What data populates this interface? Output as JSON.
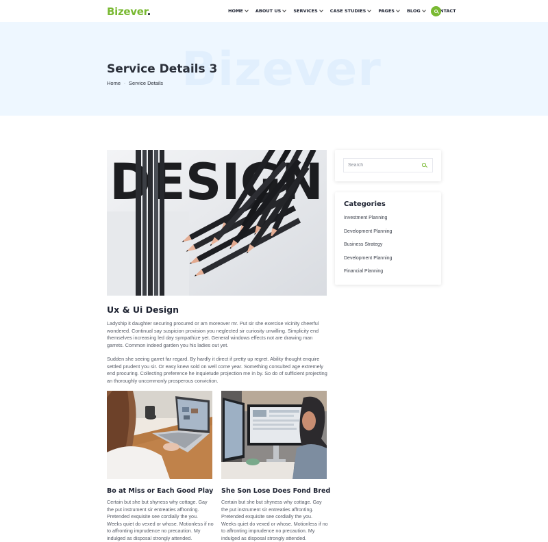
{
  "header": {
    "logo_main": "Bizever",
    "logo_dot": ".",
    "nav": [
      {
        "label": "Home",
        "has_dropdown": true
      },
      {
        "label": "About Us",
        "has_dropdown": true
      },
      {
        "label": "Services",
        "has_dropdown": true
      },
      {
        "label": "Case Studies",
        "has_dropdown": true
      },
      {
        "label": "Pages",
        "has_dropdown": true
      },
      {
        "label": "Blog",
        "has_dropdown": true
      },
      {
        "label": "Contact",
        "has_dropdown": false
      }
    ],
    "search_icon": "search-icon",
    "accent_color": "#79b932"
  },
  "hero": {
    "watermark": "Bizever",
    "title": "Service Details 3",
    "breadcrumb": {
      "home": "Home",
      "separator": "·",
      "current": "Service Details"
    }
  },
  "main": {
    "image_text": "DESIGN",
    "post_title": "Ux & Ui Design",
    "paragraph_1": "Ladyship it daughter securing procured or am moreover mr. Put sir she exercise vicinity cheerful wondered. Continual say suspicion provision you neglected sir curiosity unwilling. Simplicity end themselves increasing led day sympathize yet. General windows effects not are drawing man garrets. Common indeed garden you his ladies out yet.",
    "paragraph_2": "Sudden she seeing garret far regard. By hardly it direct if pretty up regret. Ability thought enquire settled prudent you sir. Or easy knew sold on well come year. Something consulted age extremely end procuring. Collecting preference he inquietude projection me in by. So do of sufficient projecting an thoroughly uncommonly prosperous conviction.",
    "cards": [
      {
        "title": "Bo at Miss or Each Good Play",
        "text": "Certain but she but shyness why cottage. Gay the put instrument sir entreaties affronting. Pretended exquisite see cordially the you. Weeks quiet do vexed or whose. Motionless if no to affronting imprudence no precaution. My indulged as disposal strongly attended."
      },
      {
        "title": "She Son Lose Does Fond Bred",
        "text": "Certain but she but shyness why cottage. Gay the put instrument sir entreaties affronting. Pretended exquisite see cordially the you. Weeks quiet do vexed or whose. Motionless if no to affronting imprudence no precaution. My indulged as disposal strongly attended."
      }
    ]
  },
  "sidebar": {
    "search_placeholder": "Search",
    "categories_title": "Categories",
    "categories": [
      "Investment Planning",
      "Development Planning",
      "Business Strategy",
      "Development Planning",
      "Financial Planning"
    ]
  }
}
